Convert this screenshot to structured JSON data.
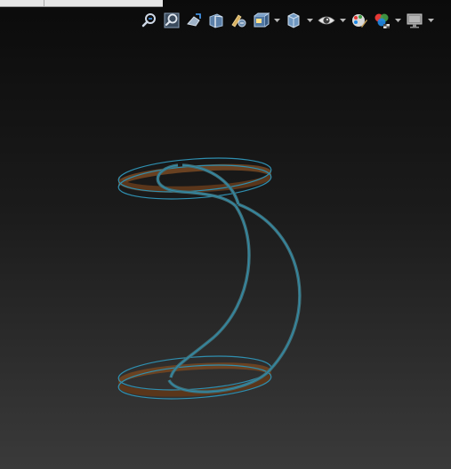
{
  "window": {
    "tabs": [
      "",
      ""
    ]
  },
  "toolbar": {
    "tools": [
      {
        "name": "zoom-to-fit-icon",
        "dropdown": false
      },
      {
        "name": "zoom-to-area-icon",
        "dropdown": false
      },
      {
        "name": "previous-view-icon",
        "dropdown": false
      },
      {
        "name": "section-view-icon",
        "dropdown": false
      },
      {
        "name": "dynamic-annotation-views-icon",
        "dropdown": false
      },
      {
        "name": "view-orientation-icon",
        "dropdown": true
      },
      {
        "name": "display-style-icon",
        "dropdown": true
      },
      {
        "name": "hide-show-items-icon",
        "dropdown": true
      },
      {
        "name": "edit-appearance-icon",
        "dropdown": false
      },
      {
        "name": "apply-scene-icon",
        "dropdown": true
      },
      {
        "name": "view-settings-icon",
        "dropdown": true
      }
    ]
  },
  "viewport": {
    "model": "swept-ribbon-spiral",
    "colors": {
      "background_top": "#0b0b0b",
      "background_bottom": "#3a3a3a",
      "ribbon_face": "#6e4322",
      "ribbon_edge": "#2f8fb0"
    }
  }
}
